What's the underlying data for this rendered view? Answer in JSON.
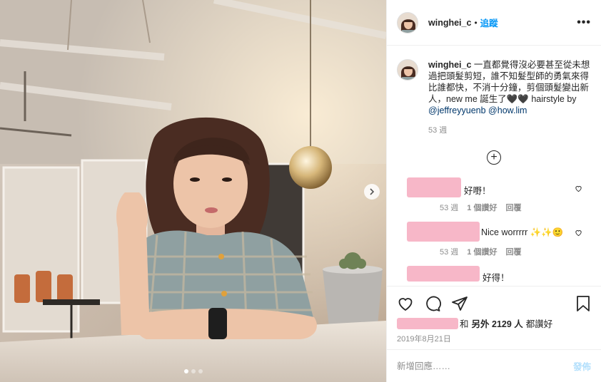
{
  "post": {
    "username": "winghei_c",
    "separator": "•",
    "follow_label": "追蹤",
    "more_label": "•••"
  },
  "caption": {
    "username": "winghei_c",
    "text": "一直都覺得沒必要甚至從未想過把頭髮剪短，誰不知髮型師的勇氣來得比誰都快，不消十分鐘，剪個頭髮變出新人，new me 誕生了🖤🖤 hairstyle by ",
    "mention1": "@jeffreyyuenb",
    "mention2": "@how.lim",
    "age": "53 週"
  },
  "load_more_label": "+",
  "comments": [
    {
      "text": "好嘢！",
      "age": "53 週",
      "likes": "1 個讚好",
      "reply": "回覆"
    },
    {
      "text": "Nice worrrrr ✨✨🙂",
      "age": "53 週",
      "likes": "1 個讚好",
      "reply": "回覆"
    },
    {
      "text": "好得！",
      "age": "",
      "likes": "",
      "reply": ""
    }
  ],
  "likes": {
    "mid": "和",
    "others": "另外 2129 人",
    "suffix": "都讚好"
  },
  "date": "2019年8月21日",
  "add_comment": {
    "placeholder": "新增回應……",
    "post_label": "發佈"
  },
  "colors": {
    "accent": "#0095f6",
    "post_disabled": "#b2dffc",
    "redaction": "#f7b7c8"
  },
  "icons": [
    "heart-icon",
    "comment-icon",
    "share-icon",
    "bookmark-icon",
    "chevron-right-icon",
    "plus-circle-icon"
  ]
}
